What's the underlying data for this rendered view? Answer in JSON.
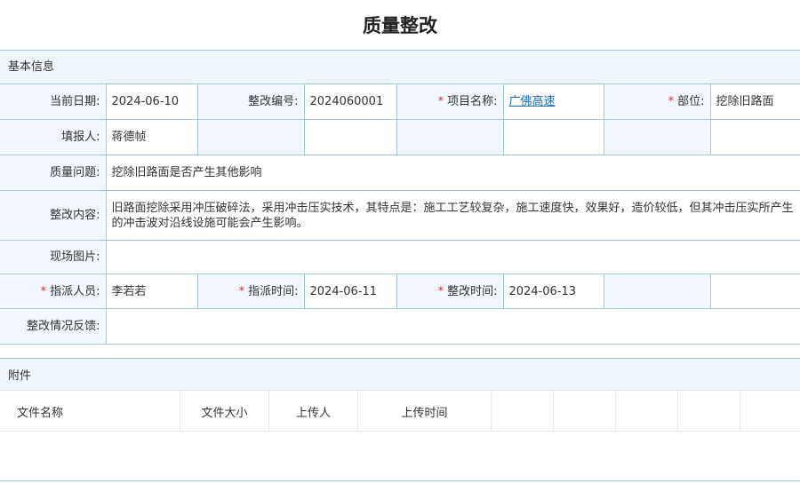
{
  "page_title": "质量整改",
  "basic_section": {
    "title": "基本信息"
  },
  "form": {
    "current_date": {
      "label": "当前日期:",
      "value": "2024-06-10"
    },
    "rectify_no": {
      "label": "整改编号:",
      "value": "2024060001"
    },
    "project_name": {
      "label": "项目名称:",
      "value": "广佛高速",
      "required": "*"
    },
    "department": {
      "label": "部位:",
      "value": "挖除旧路面",
      "required": "*"
    },
    "reporter": {
      "label": "填报人:",
      "value": "蒋德帧"
    },
    "quality_issue": {
      "label": "质量问题:",
      "value": "挖除旧路面是否产生其他影响"
    },
    "rectify_content": {
      "label": "整改内容:",
      "value": "旧路面挖除采用冲压破碎法，采用冲击压实技术，其特点是：施工工艺较复杂，施工速度快，效果好，造价较低，但其冲击压实所产生的冲击波对沿线设施可能会产生影响。"
    },
    "site_photos": {
      "label": "现场图片:",
      "value": ""
    },
    "assignee": {
      "label": "指派人员:",
      "value": "李若若",
      "required": "*"
    },
    "assign_time": {
      "label": "指派时间:",
      "value": "2024-06-11",
      "required": "*"
    },
    "rectify_time": {
      "label": "整改时间:",
      "value": "2024-06-13",
      "required": "*"
    },
    "feedback": {
      "label": "整改情况反馈:",
      "value": ""
    }
  },
  "attachments": {
    "title": "附件",
    "columns": [
      "文件名称",
      "文件大小",
      "上传人",
      "上传时间"
    ]
  }
}
